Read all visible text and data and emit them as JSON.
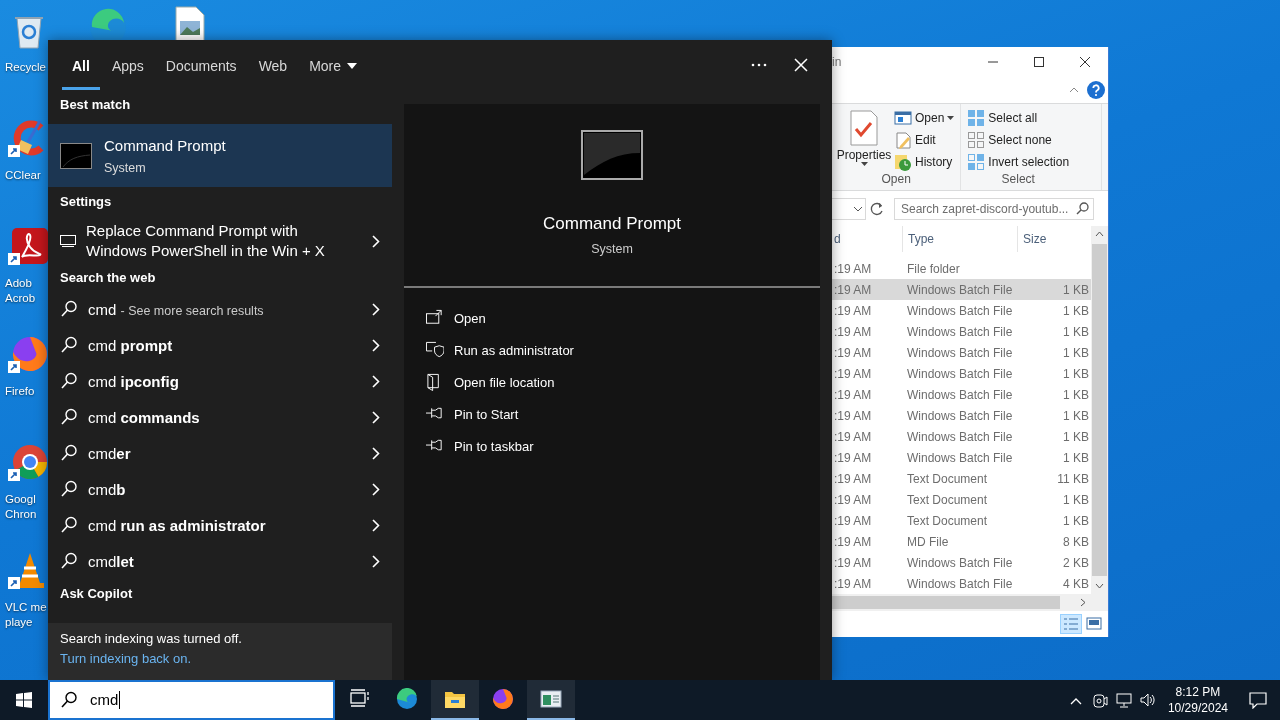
{
  "desktop": {
    "icons": [
      {
        "kind": "recycle-bin",
        "shortcut": false,
        "label_lines": [
          "Recycle"
        ]
      },
      {
        "kind": "cleaner",
        "shortcut": true,
        "label_lines": [
          "CClear"
        ]
      },
      {
        "kind": "pdf-reader",
        "shortcut": true,
        "label_lines": [
          "Adob",
          "Acrob"
        ]
      },
      {
        "kind": "firefox",
        "shortcut": true,
        "label_lines": [
          "Firefo"
        ]
      },
      {
        "kind": "chrome",
        "shortcut": true,
        "label_lines": [
          "Googl",
          "Chron"
        ]
      },
      {
        "kind": "vlc",
        "shortcut": true,
        "label_lines": [
          "VLC me",
          "playe"
        ]
      }
    ],
    "top_icons": [
      {
        "kind": "edge"
      },
      {
        "kind": "image-file"
      }
    ]
  },
  "explorer": {
    "title": "in",
    "ribbon": {
      "properties": "Properties",
      "groups": [
        {
          "label": "Open",
          "items": [
            {
              "kind": "open",
              "label": "Open",
              "dropdown": true
            },
            {
              "kind": "edit",
              "label": "Edit",
              "dropdown": false
            },
            {
              "kind": "history",
              "label": "History",
              "dropdown": false
            }
          ]
        },
        {
          "label": "Select",
          "items": [
            {
              "kind": "select-all",
              "label": "Select all",
              "dropdown": false
            },
            {
              "kind": "select-none",
              "label": "Select none",
              "dropdown": false
            },
            {
              "kind": "invert",
              "label": "Invert selection",
              "dropdown": false
            }
          ]
        }
      ]
    },
    "search": {
      "placeholder": "Search zapret-discord-youtub..."
    },
    "columns": [
      "d",
      "Type",
      "Size"
    ],
    "rows": [
      {
        "modified": ":19 AM",
        "type": "File folder",
        "selected": false
      },
      {
        "modified": ":19 AM",
        "type": "Windows Batch File",
        "size": "1 KB",
        "selected": true
      },
      {
        "modified": ":19 AM",
        "type": "Windows Batch File",
        "size": "1 KB",
        "selected": false
      },
      {
        "modified": ":19 AM",
        "type": "Windows Batch File",
        "size": "1 KB",
        "selected": false
      },
      {
        "modified": ":19 AM",
        "type": "Windows Batch File",
        "size": "1 KB",
        "selected": false
      },
      {
        "modified": ":19 AM",
        "type": "Windows Batch File",
        "size": "1 KB",
        "selected": false
      },
      {
        "modified": ":19 AM",
        "type": "Windows Batch File",
        "size": "1 KB",
        "selected": false
      },
      {
        "modified": ":19 AM",
        "type": "Windows Batch File",
        "size": "1 KB",
        "selected": false
      },
      {
        "modified": ":19 AM",
        "type": "Windows Batch File",
        "size": "1 KB",
        "selected": false
      },
      {
        "modified": ":19 AM",
        "type": "Windows Batch File",
        "size": "1 KB",
        "selected": false
      },
      {
        "modified": ":19 AM",
        "type": "Text Document",
        "size": "11 KB",
        "selected": false
      },
      {
        "modified": ":19 AM",
        "type": "Text Document",
        "size": "1 KB",
        "selected": false
      },
      {
        "modified": ":19 AM",
        "type": "Text Document",
        "size": "1 KB",
        "selected": false
      },
      {
        "modified": ":19 AM",
        "type": "MD File",
        "size": "8 KB",
        "selected": false
      },
      {
        "modified": ":19 AM",
        "type": "Windows Batch File",
        "size": "2 KB",
        "selected": false
      },
      {
        "modified": ":19 AM",
        "type": "Windows Batch File",
        "size": "4 KB",
        "selected": false
      }
    ]
  },
  "search_panel": {
    "tabs": [
      {
        "label": "All",
        "selected": true,
        "dropdown": false
      },
      {
        "label": "Apps",
        "selected": false,
        "dropdown": false
      },
      {
        "label": "Documents",
        "selected": false,
        "dropdown": false
      },
      {
        "label": "Web",
        "selected": false,
        "dropdown": false
      },
      {
        "label": "More",
        "selected": false,
        "dropdown": true
      }
    ],
    "best_match": {
      "heading": "Best match",
      "title": "Command Prompt",
      "subtitle": "System",
      "selected": true
    },
    "settings": {
      "heading": "Settings",
      "items": [
        {
          "text": "Replace Command Prompt with Windows PowerShell in the Win + X"
        }
      ]
    },
    "web": {
      "heading": "Search the web",
      "items": [
        {
          "text": "cmd",
          "note": "- See more search results"
        },
        {
          "text": "cmd **prompt**"
        },
        {
          "text": "cmd **ipconfig**"
        },
        {
          "text": "cmd **commands**"
        },
        {
          "text": "cmd**er**"
        },
        {
          "text": "cmd**b**"
        },
        {
          "text": "cmd **run as administrator**"
        },
        {
          "text": "cmd**let**"
        }
      ]
    },
    "copilot": {
      "heading": "Ask Copilot"
    },
    "notice": {
      "text": "Search indexing was turned off.",
      "link": "Turn indexing back on."
    },
    "detail": {
      "title": "Command Prompt",
      "subtitle": "System",
      "actions": [
        {
          "kind": "open",
          "label": "Open"
        },
        {
          "kind": "admin",
          "label": "Run as administrator"
        },
        {
          "kind": "location",
          "label": "Open file location"
        },
        {
          "kind": "pin",
          "label": "Pin to Start"
        },
        {
          "kind": "pin",
          "label": "Pin to taskbar"
        }
      ]
    }
  },
  "taskbar": {
    "search_value": "cmd",
    "apps": [
      {
        "kind": "task-view",
        "running": false
      },
      {
        "kind": "edge",
        "running": false
      },
      {
        "kind": "explorer",
        "running": true
      },
      {
        "kind": "firefox",
        "running": false
      },
      {
        "kind": "app-window",
        "running": true
      }
    ],
    "clock": {
      "time": "8:12 PM",
      "date": "10/29/2024"
    }
  }
}
